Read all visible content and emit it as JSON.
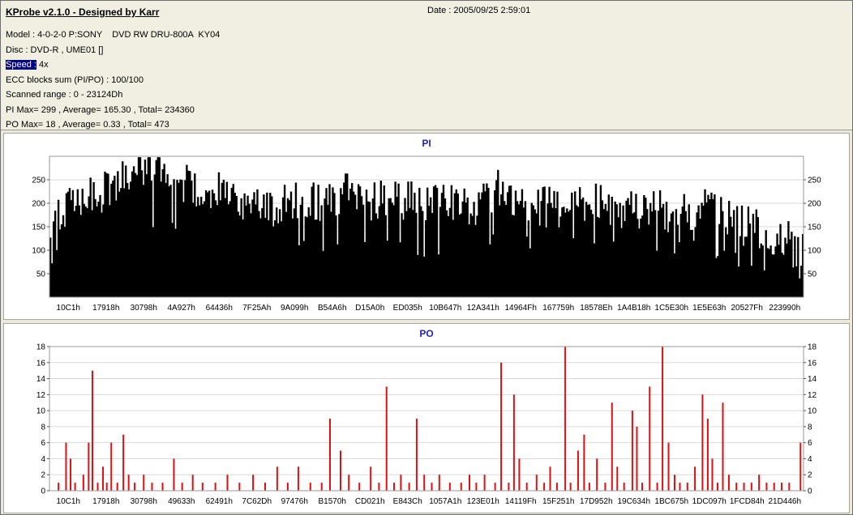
{
  "window": {
    "app_title": "KProbe v2.1.0 - Designed by Karr",
    "date": "Date : 2005/09/25 2:59:01"
  },
  "info": {
    "model": "Model : 4-0-2-0 P:SONY    DVD RW DRU-800A  KY04",
    "disc": "Disc : DVD-R , UME01 []",
    "speed_label": "Speed :",
    "speed_value": " 4x",
    "ecc": "ECC blocks sum (PI/PO) : 100/100",
    "range": "Scanned range : 0 - 23124Dh",
    "pi_stats": "PI Max= 299 , Average= 165.30 , Total= 234360",
    "po_stats": "PO Max= 18 , Average= 0.33 , Total= 473"
  },
  "colors": {
    "background": "#ECE9D8",
    "chart_title": "#2222CC",
    "pi_bar": "#000000",
    "po_bar": "#DD1111",
    "grid": "#DADADA",
    "highlight": "#000080"
  },
  "chart_data": [
    {
      "id": "pi",
      "type": "bar",
      "title": "PI",
      "bar_color": "#000000",
      "ylim": [
        0,
        300
      ],
      "yticks": [
        50,
        100,
        150,
        200,
        250
      ],
      "grid": true,
      "legend": "none",
      "x_labels": [
        "10C1h",
        "17918h",
        "30798h",
        "4A927h",
        "64436h",
        "7F25Ah",
        "9A099h",
        "B54A6h",
        "D15A0h",
        "ED035h",
        "10B647h",
        "12A341h",
        "14964Fh",
        "167759h",
        "18578Eh",
        "1A4B18h",
        "1C5E30h",
        "1E5E63h",
        "20527Fh",
        "223990h"
      ],
      "stats": {
        "max": 299,
        "average": 165.3,
        "total": 234360
      },
      "envelope": [
        [
          0,
          170
        ],
        [
          0.01,
          185
        ],
        [
          0.025,
          195
        ],
        [
          0.04,
          200
        ],
        [
          0.06,
          215
        ],
        [
          0.08,
          235
        ],
        [
          0.1,
          255
        ],
        [
          0.115,
          275
        ],
        [
          0.13,
          285
        ],
        [
          0.145,
          280
        ],
        [
          0.16,
          265
        ],
        [
          0.175,
          245
        ],
        [
          0.19,
          235
        ],
        [
          0.205,
          240
        ],
        [
          0.22,
          230
        ],
        [
          0.24,
          215
        ],
        [
          0.26,
          200
        ],
        [
          0.28,
          195
        ],
        [
          0.3,
          195
        ],
        [
          0.32,
          200
        ],
        [
          0.34,
          205
        ],
        [
          0.36,
          200
        ],
        [
          0.38,
          210
        ],
        [
          0.4,
          230
        ],
        [
          0.415,
          215
        ],
        [
          0.43,
          205
        ],
        [
          0.45,
          210
        ],
        [
          0.47,
          205
        ],
        [
          0.49,
          200
        ],
        [
          0.51,
          205
        ],
        [
          0.53,
          200
        ],
        [
          0.55,
          195
        ],
        [
          0.57,
          200
        ],
        [
          0.59,
          220
        ],
        [
          0.6,
          245
        ],
        [
          0.61,
          215
        ],
        [
          0.63,
          195
        ],
        [
          0.65,
          190
        ],
        [
          0.67,
          195
        ],
        [
          0.69,
          185
        ],
        [
          0.71,
          195
        ],
        [
          0.73,
          205
        ],
        [
          0.75,
          190
        ],
        [
          0.77,
          185
        ],
        [
          0.79,
          195
        ],
        [
          0.81,
          185
        ],
        [
          0.83,
          180
        ],
        [
          0.85,
          185
        ],
        [
          0.87,
          195
        ],
        [
          0.89,
          175
        ],
        [
          0.905,
          160
        ],
        [
          0.92,
          150
        ],
        [
          0.94,
          145
        ],
        [
          0.955,
          135
        ],
        [
          0.97,
          125
        ],
        [
          0.985,
          115
        ],
        [
          1,
          95
        ]
      ],
      "noise": 45,
      "dip_chance": 0.06,
      "bars": 470,
      "seed": 20050925
    },
    {
      "id": "po",
      "type": "bar",
      "title": "PO",
      "bar_color": "#DD1111",
      "ylim": [
        0,
        18
      ],
      "yticks": [
        0,
        2,
        4,
        6,
        8,
        10,
        12,
        14,
        16,
        18
      ],
      "grid": true,
      "legend": "none",
      "x_labels": [
        "10C1h",
        "17918h",
        "30798h",
        "49633h",
        "62491h",
        "7C62Dh",
        "97476h",
        "B1570h",
        "CD021h",
        "E843Ch",
        "1057A1h",
        "123E01h",
        "14119Fh",
        "15F251h",
        "17D952h",
        "19C634h",
        "1BC675h",
        "1DC097h",
        "1FCD84h",
        "21D446h"
      ],
      "stats": {
        "max": 18,
        "average": 0.33,
        "total": 473
      },
      "spikes": [
        [
          0.012,
          1
        ],
        [
          0.022,
          6
        ],
        [
          0.028,
          4
        ],
        [
          0.034,
          1
        ],
        [
          0.045,
          2
        ],
        [
          0.052,
          6
        ],
        [
          0.057,
          15
        ],
        [
          0.064,
          1
        ],
        [
          0.071,
          3
        ],
        [
          0.076,
          1
        ],
        [
          0.082,
          6
        ],
        [
          0.09,
          1
        ],
        [
          0.098,
          7
        ],
        [
          0.105,
          2
        ],
        [
          0.113,
          1
        ],
        [
          0.125,
          2
        ],
        [
          0.136,
          1
        ],
        [
          0.15,
          1
        ],
        [
          0.165,
          4
        ],
        [
          0.176,
          1
        ],
        [
          0.19,
          2
        ],
        [
          0.203,
          1
        ],
        [
          0.22,
          1
        ],
        [
          0.236,
          2
        ],
        [
          0.252,
          1
        ],
        [
          0.27,
          2
        ],
        [
          0.286,
          1
        ],
        [
          0.302,
          3
        ],
        [
          0.316,
          1
        ],
        [
          0.33,
          3
        ],
        [
          0.346,
          1
        ],
        [
          0.361,
          1
        ],
        [
          0.372,
          9
        ],
        [
          0.386,
          5
        ],
        [
          0.397,
          2
        ],
        [
          0.411,
          1
        ],
        [
          0.426,
          3
        ],
        [
          0.437,
          1
        ],
        [
          0.447,
          13
        ],
        [
          0.457,
          1
        ],
        [
          0.466,
          2
        ],
        [
          0.477,
          1
        ],
        [
          0.487,
          9
        ],
        [
          0.497,
          2
        ],
        [
          0.507,
          1
        ],
        [
          0.517,
          2
        ],
        [
          0.531,
          1
        ],
        [
          0.546,
          1
        ],
        [
          0.557,
          2
        ],
        [
          0.566,
          1
        ],
        [
          0.577,
          2
        ],
        [
          0.591,
          1
        ],
        [
          0.599,
          16
        ],
        [
          0.609,
          1
        ],
        [
          0.616,
          12
        ],
        [
          0.623,
          4
        ],
        [
          0.633,
          1
        ],
        [
          0.646,
          2
        ],
        [
          0.656,
          1
        ],
        [
          0.664,
          3
        ],
        [
          0.673,
          1
        ],
        [
          0.684,
          18
        ],
        [
          0.691,
          1
        ],
        [
          0.701,
          5
        ],
        [
          0.709,
          7
        ],
        [
          0.716,
          1
        ],
        [
          0.726,
          4
        ],
        [
          0.737,
          1
        ],
        [
          0.746,
          11
        ],
        [
          0.753,
          3
        ],
        [
          0.762,
          1
        ],
        [
          0.773,
          10
        ],
        [
          0.779,
          8
        ],
        [
          0.786,
          1
        ],
        [
          0.796,
          13
        ],
        [
          0.806,
          1
        ],
        [
          0.813,
          18
        ],
        [
          0.821,
          6
        ],
        [
          0.829,
          2
        ],
        [
          0.836,
          1
        ],
        [
          0.846,
          1
        ],
        [
          0.856,
          3
        ],
        [
          0.866,
          12
        ],
        [
          0.873,
          9
        ],
        [
          0.879,
          4
        ],
        [
          0.886,
          1
        ],
        [
          0.893,
          11
        ],
        [
          0.901,
          2
        ],
        [
          0.911,
          1
        ],
        [
          0.921,
          1
        ],
        [
          0.931,
          1
        ],
        [
          0.941,
          2
        ],
        [
          0.951,
          1
        ],
        [
          0.961,
          1
        ],
        [
          0.971,
          1
        ],
        [
          0.981,
          1
        ],
        [
          0.996,
          6
        ]
      ]
    }
  ]
}
